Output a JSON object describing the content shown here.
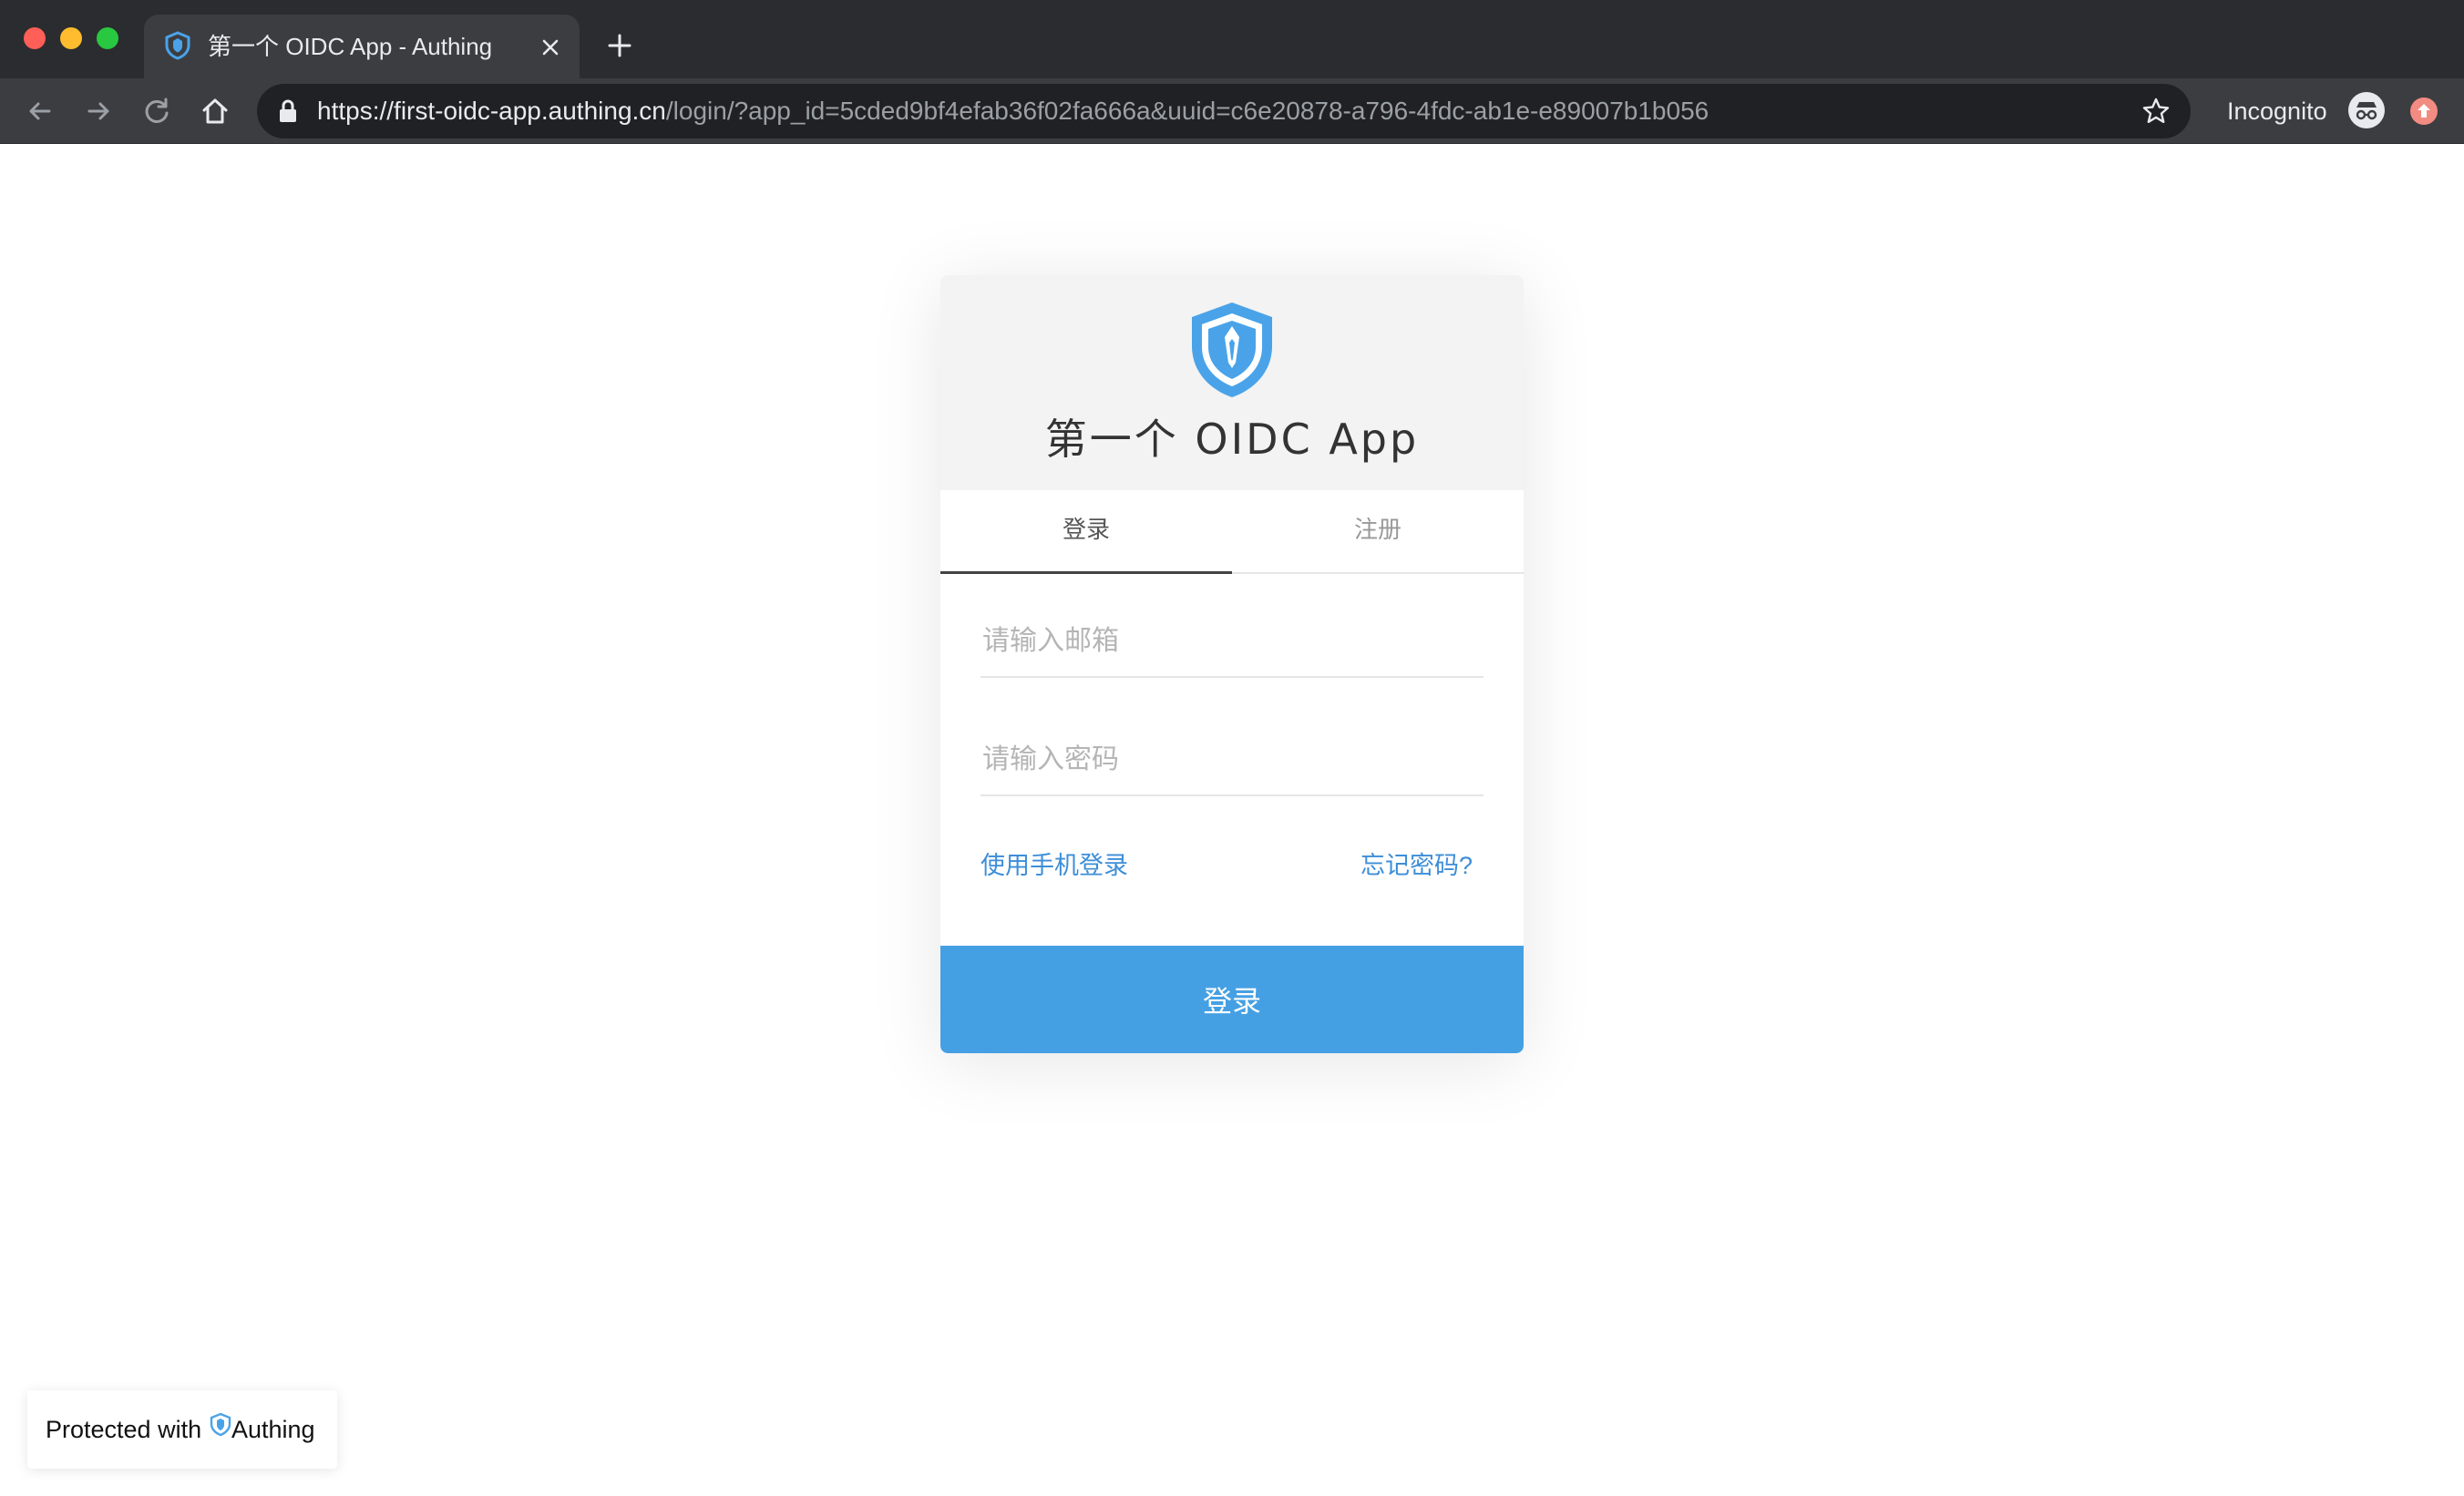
{
  "browser": {
    "tab": {
      "title": "第一个 OIDC App - Authing"
    },
    "omnibox": {
      "url_host": "https://first-oidc-app.authing.cn",
      "url_path": "/login/?app_id=5cded9bf4efab36f02fa666a&uuid=c6e20878-a796-4fdc-ab1e-e89007b1b056"
    },
    "incognito_label": "Incognito"
  },
  "login": {
    "app_title": "第一个 OIDC App",
    "tabs": [
      {
        "label": "登录"
      },
      {
        "label": "注册"
      }
    ],
    "email_placeholder": "请输入邮箱",
    "password_placeholder": "请输入密码",
    "phone_login_link": "使用手机登录",
    "forgot_password_link": "忘记密码?",
    "submit_label": "登录"
  },
  "badge": {
    "prefix": "Protected with",
    "brand": "Authing"
  },
  "colors": {
    "brand_blue": "#45a0e3",
    "link_blue": "#3d8ed8",
    "chrome_dark": "#2b2c2f"
  }
}
